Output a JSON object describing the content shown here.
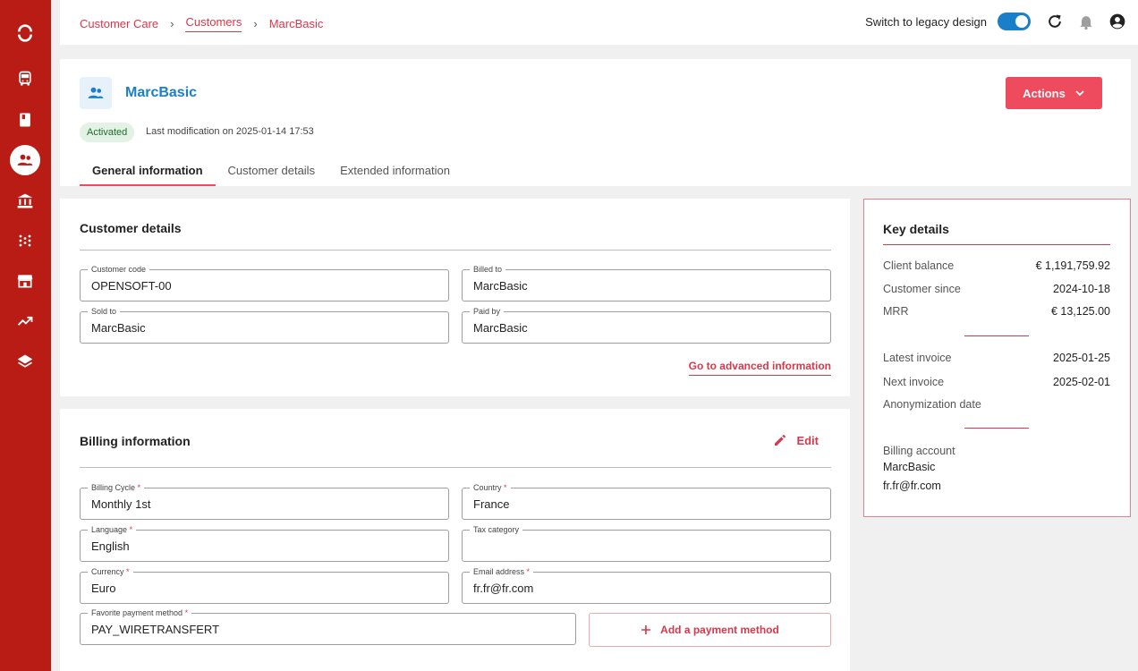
{
  "breadcrumb": [
    "Customer Care",
    "Customers",
    "MarcBasic"
  ],
  "topbar": {
    "legacy_label": "Switch to legacy design"
  },
  "header": {
    "name": "MarcBasic",
    "actions_label": "Actions",
    "status": "Activated",
    "last_modification": "Last modification on 2025-01-14 17:53",
    "tabs": [
      "General information",
      "Customer details",
      "Extended information"
    ]
  },
  "customer_details": {
    "title": "Customer details",
    "fields": [
      {
        "label": "Customer code",
        "value": "OPENSOFT-00"
      },
      {
        "label": "Billed to",
        "value": "MarcBasic"
      },
      {
        "label": "Sold to",
        "value": "MarcBasic"
      },
      {
        "label": "Paid by",
        "value": "MarcBasic"
      }
    ],
    "advanced_link": "Go to advanced information"
  },
  "billing": {
    "title": "Billing information",
    "edit_label": "Edit",
    "fields": [
      {
        "label": "Billing Cycle",
        "value": "Monthly 1st"
      },
      {
        "label": "Country",
        "value": "France"
      },
      {
        "label": "Language",
        "value": "English"
      },
      {
        "label": "Tax category",
        "value": ""
      },
      {
        "label": "Currency",
        "value": "Euro"
      },
      {
        "label": "Email address",
        "value": "fr.fr@fr.com"
      },
      {
        "label": "Favorite payment method",
        "value": "PAY_WIRETRANSFERT"
      }
    ],
    "required_mark": "*",
    "add_payment_label": "Add a payment method"
  },
  "key_details": {
    "title": "Key details",
    "group1": [
      {
        "label": "Client balance",
        "value": "€ 1,191,759.92"
      },
      {
        "label": "Customer since",
        "value": "2024-10-18"
      },
      {
        "label": "MRR",
        "value": "€ 13,125.00"
      }
    ],
    "group2": [
      {
        "label": "Latest invoice",
        "value": "2025-01-25"
      },
      {
        "label": "Next invoice",
        "value": "2025-02-01"
      },
      {
        "label": "Anonymization date",
        "value": ""
      }
    ],
    "billing_account_label": "Billing account",
    "billing_account_name": "MarcBasic",
    "billing_account_email": "fr.fr@fr.com"
  },
  "colors": {
    "brand_red": "#b81c14",
    "accent": "#ee4b5e",
    "link_blue": "#1a7fc9"
  }
}
